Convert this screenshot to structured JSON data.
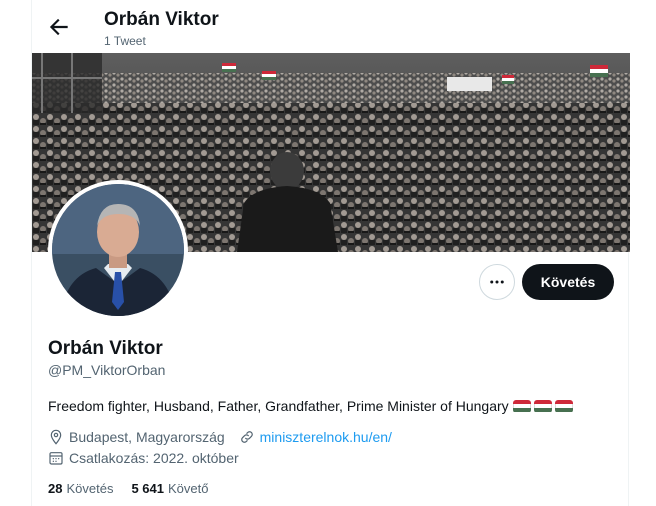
{
  "header": {
    "name": "Orbán Viktor",
    "tweet_count": "1 Tweet"
  },
  "profile": {
    "display_name": "Orbán Viktor",
    "handle": "@PM_ViktorOrban",
    "bio": "Freedom fighter, Husband, Father, Grandfather, Prime Minister of Hungary",
    "bio_emoji": [
      "hungary-flag",
      "hungary-flag",
      "hungary-flag"
    ],
    "location": "Budapest, Magyarország",
    "website": "miniszterelnok.hu/en/",
    "joined": "Csatlakozás: 2022. október",
    "following_count": "28",
    "following_label": "Követés",
    "followers_count": "5 641",
    "followers_label": "Követő"
  },
  "actions": {
    "follow_label": "Követés",
    "more_icon": "more-icon"
  },
  "colors": {
    "accent": "#1d9bf0",
    "button_dark": "#0f1419",
    "secondary_text": "#536471",
    "flag_red": "#ce2939",
    "flag_white": "#ffffff",
    "flag_green": "#477050"
  }
}
